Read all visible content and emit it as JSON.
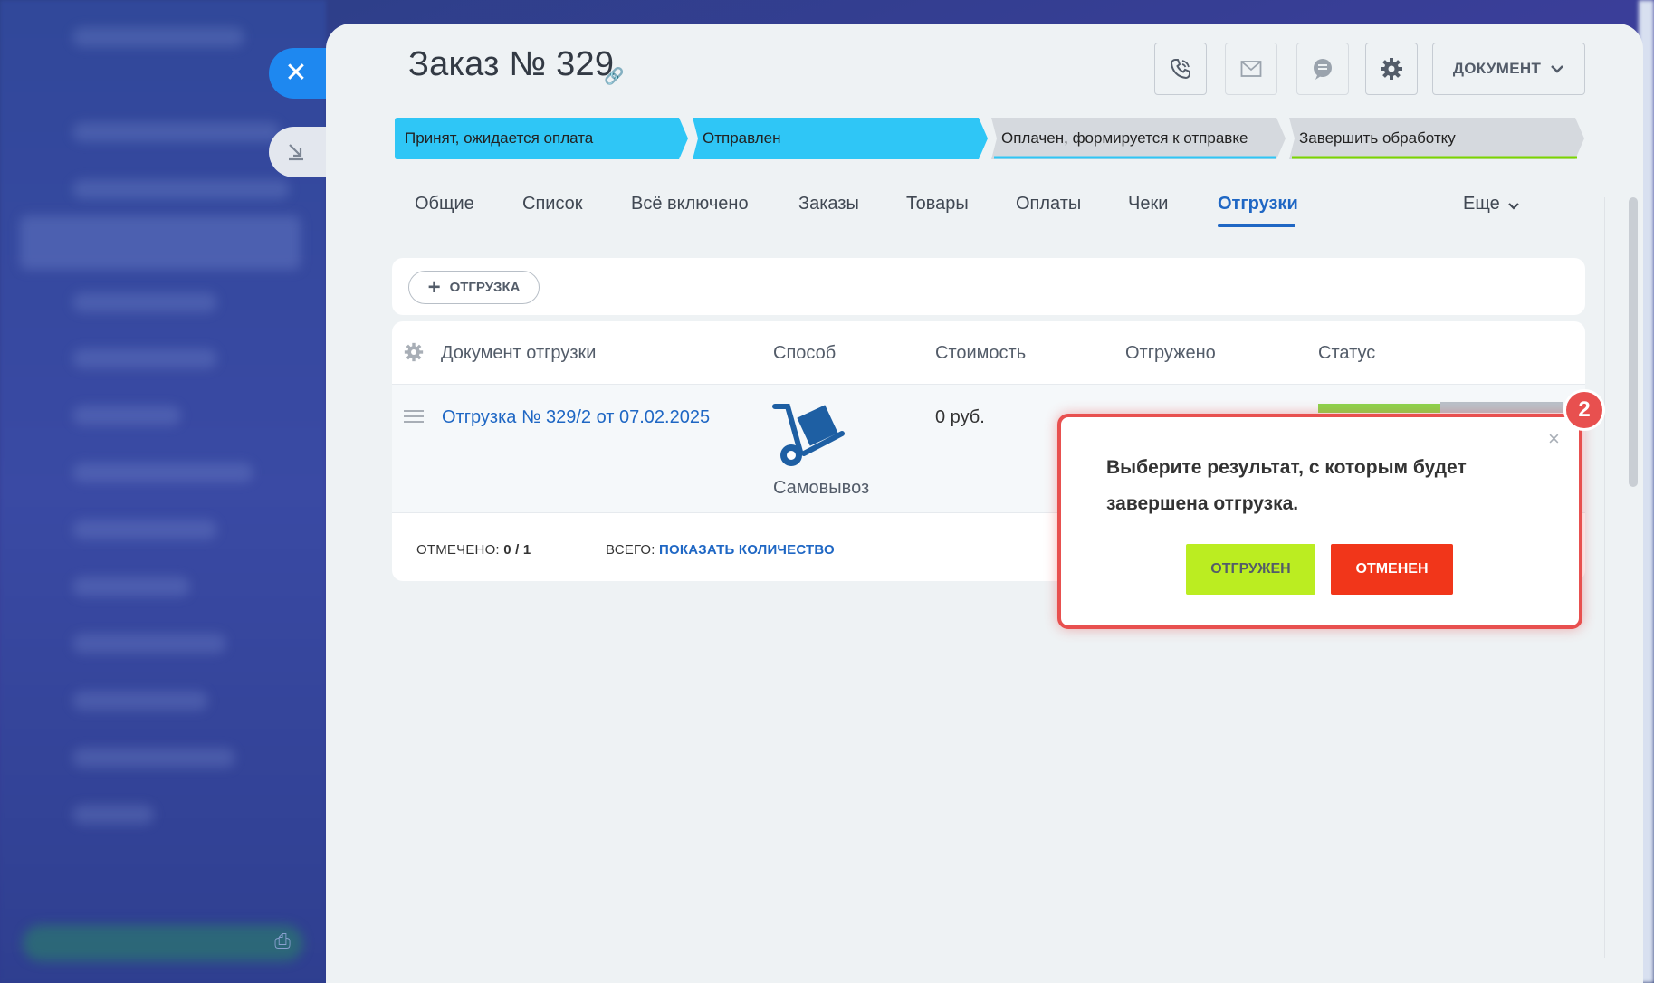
{
  "order": {
    "title": "Заказ № 329"
  },
  "toolbar": {
    "document_label": "ДОКУМЕНТ"
  },
  "stages": [
    {
      "label": "Принят, ожидается оплата",
      "color": "#2fc6f6"
    },
    {
      "label": "Отправлен",
      "color": "#2fc6f6"
    },
    {
      "label": "Оплачен, формируется к отправке",
      "color": "#d5d9de"
    },
    {
      "label": "Завершить обработку",
      "color": "#d5d9de"
    }
  ],
  "tabs": [
    "Общие",
    "Список",
    "Всё включено",
    "Заказы",
    "Товары",
    "Оплаты",
    "Чеки",
    "Отгрузки",
    "Еще"
  ],
  "active_tab": "Отгрузки",
  "add_button": {
    "label": "ОТГРУЗКА"
  },
  "table": {
    "headers": [
      "Документ отгрузки",
      "Способ",
      "Стоимость",
      "Отгружено",
      "Статус"
    ],
    "rows": [
      {
        "document": "Отгрузка № 329/2 от 07.02.2025",
        "method": "Самовывоз",
        "cost": "0 руб."
      }
    ]
  },
  "footer": {
    "checked_label": "ОТМЕЧЕНО:",
    "checked_value": "0 / 1",
    "total_label": "ВСЕГО:",
    "total_link": "ПОКАЗАТЬ КОЛИЧЕСТВО"
  },
  "popup": {
    "message": "Выберите результат, с которым будет завершена отгрузка.",
    "ok_label": "ОТГРУЖЕН",
    "cancel_label": "ОТМЕНЕН"
  },
  "badge": {
    "number": "2"
  },
  "colors": {
    "accent": "#1f67c4",
    "stage_active": "#2fc6f6",
    "ok_button": "#bbed21",
    "cancel_button": "#f1361a",
    "highlight": "#e8504f"
  }
}
